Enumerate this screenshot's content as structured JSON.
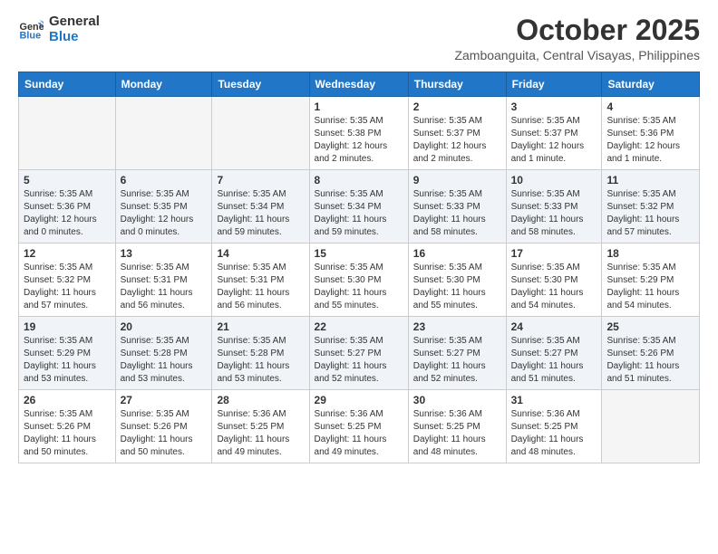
{
  "header": {
    "logo_line1": "General",
    "logo_line2": "Blue",
    "month": "October 2025",
    "location": "Zamboanguita, Central Visayas, Philippines"
  },
  "days_of_week": [
    "Sunday",
    "Monday",
    "Tuesday",
    "Wednesday",
    "Thursday",
    "Friday",
    "Saturday"
  ],
  "weeks": [
    [
      {
        "day": "",
        "empty": true
      },
      {
        "day": "",
        "empty": true
      },
      {
        "day": "",
        "empty": true
      },
      {
        "day": "1",
        "sunrise": "Sunrise: 5:35 AM",
        "sunset": "Sunset: 5:38 PM",
        "daylight": "Daylight: 12 hours and 2 minutes."
      },
      {
        "day": "2",
        "sunrise": "Sunrise: 5:35 AM",
        "sunset": "Sunset: 5:37 PM",
        "daylight": "Daylight: 12 hours and 2 minutes."
      },
      {
        "day": "3",
        "sunrise": "Sunrise: 5:35 AM",
        "sunset": "Sunset: 5:37 PM",
        "daylight": "Daylight: 12 hours and 1 minute."
      },
      {
        "day": "4",
        "sunrise": "Sunrise: 5:35 AM",
        "sunset": "Sunset: 5:36 PM",
        "daylight": "Daylight: 12 hours and 1 minute."
      }
    ],
    [
      {
        "day": "5",
        "sunrise": "Sunrise: 5:35 AM",
        "sunset": "Sunset: 5:36 PM",
        "daylight": "Daylight: 12 hours and 0 minutes."
      },
      {
        "day": "6",
        "sunrise": "Sunrise: 5:35 AM",
        "sunset": "Sunset: 5:35 PM",
        "daylight": "Daylight: 12 hours and 0 minutes."
      },
      {
        "day": "7",
        "sunrise": "Sunrise: 5:35 AM",
        "sunset": "Sunset: 5:34 PM",
        "daylight": "Daylight: 11 hours and 59 minutes."
      },
      {
        "day": "8",
        "sunrise": "Sunrise: 5:35 AM",
        "sunset": "Sunset: 5:34 PM",
        "daylight": "Daylight: 11 hours and 59 minutes."
      },
      {
        "day": "9",
        "sunrise": "Sunrise: 5:35 AM",
        "sunset": "Sunset: 5:33 PM",
        "daylight": "Daylight: 11 hours and 58 minutes."
      },
      {
        "day": "10",
        "sunrise": "Sunrise: 5:35 AM",
        "sunset": "Sunset: 5:33 PM",
        "daylight": "Daylight: 11 hours and 58 minutes."
      },
      {
        "day": "11",
        "sunrise": "Sunrise: 5:35 AM",
        "sunset": "Sunset: 5:32 PM",
        "daylight": "Daylight: 11 hours and 57 minutes."
      }
    ],
    [
      {
        "day": "12",
        "sunrise": "Sunrise: 5:35 AM",
        "sunset": "Sunset: 5:32 PM",
        "daylight": "Daylight: 11 hours and 57 minutes."
      },
      {
        "day": "13",
        "sunrise": "Sunrise: 5:35 AM",
        "sunset": "Sunset: 5:31 PM",
        "daylight": "Daylight: 11 hours and 56 minutes."
      },
      {
        "day": "14",
        "sunrise": "Sunrise: 5:35 AM",
        "sunset": "Sunset: 5:31 PM",
        "daylight": "Daylight: 11 hours and 56 minutes."
      },
      {
        "day": "15",
        "sunrise": "Sunrise: 5:35 AM",
        "sunset": "Sunset: 5:30 PM",
        "daylight": "Daylight: 11 hours and 55 minutes."
      },
      {
        "day": "16",
        "sunrise": "Sunrise: 5:35 AM",
        "sunset": "Sunset: 5:30 PM",
        "daylight": "Daylight: 11 hours and 55 minutes."
      },
      {
        "day": "17",
        "sunrise": "Sunrise: 5:35 AM",
        "sunset": "Sunset: 5:30 PM",
        "daylight": "Daylight: 11 hours and 54 minutes."
      },
      {
        "day": "18",
        "sunrise": "Sunrise: 5:35 AM",
        "sunset": "Sunset: 5:29 PM",
        "daylight": "Daylight: 11 hours and 54 minutes."
      }
    ],
    [
      {
        "day": "19",
        "sunrise": "Sunrise: 5:35 AM",
        "sunset": "Sunset: 5:29 PM",
        "daylight": "Daylight: 11 hours and 53 minutes."
      },
      {
        "day": "20",
        "sunrise": "Sunrise: 5:35 AM",
        "sunset": "Sunset: 5:28 PM",
        "daylight": "Daylight: 11 hours and 53 minutes."
      },
      {
        "day": "21",
        "sunrise": "Sunrise: 5:35 AM",
        "sunset": "Sunset: 5:28 PM",
        "daylight": "Daylight: 11 hours and 53 minutes."
      },
      {
        "day": "22",
        "sunrise": "Sunrise: 5:35 AM",
        "sunset": "Sunset: 5:27 PM",
        "daylight": "Daylight: 11 hours and 52 minutes."
      },
      {
        "day": "23",
        "sunrise": "Sunrise: 5:35 AM",
        "sunset": "Sunset: 5:27 PM",
        "daylight": "Daylight: 11 hours and 52 minutes."
      },
      {
        "day": "24",
        "sunrise": "Sunrise: 5:35 AM",
        "sunset": "Sunset: 5:27 PM",
        "daylight": "Daylight: 11 hours and 51 minutes."
      },
      {
        "day": "25",
        "sunrise": "Sunrise: 5:35 AM",
        "sunset": "Sunset: 5:26 PM",
        "daylight": "Daylight: 11 hours and 51 minutes."
      }
    ],
    [
      {
        "day": "26",
        "sunrise": "Sunrise: 5:35 AM",
        "sunset": "Sunset: 5:26 PM",
        "daylight": "Daylight: 11 hours and 50 minutes."
      },
      {
        "day": "27",
        "sunrise": "Sunrise: 5:35 AM",
        "sunset": "Sunset: 5:26 PM",
        "daylight": "Daylight: 11 hours and 50 minutes."
      },
      {
        "day": "28",
        "sunrise": "Sunrise: 5:36 AM",
        "sunset": "Sunset: 5:25 PM",
        "daylight": "Daylight: 11 hours and 49 minutes."
      },
      {
        "day": "29",
        "sunrise": "Sunrise: 5:36 AM",
        "sunset": "Sunset: 5:25 PM",
        "daylight": "Daylight: 11 hours and 49 minutes."
      },
      {
        "day": "30",
        "sunrise": "Sunrise: 5:36 AM",
        "sunset": "Sunset: 5:25 PM",
        "daylight": "Daylight: 11 hours and 48 minutes."
      },
      {
        "day": "31",
        "sunrise": "Sunrise: 5:36 AM",
        "sunset": "Sunset: 5:25 PM",
        "daylight": "Daylight: 11 hours and 48 minutes."
      },
      {
        "day": "",
        "empty": true
      }
    ]
  ]
}
